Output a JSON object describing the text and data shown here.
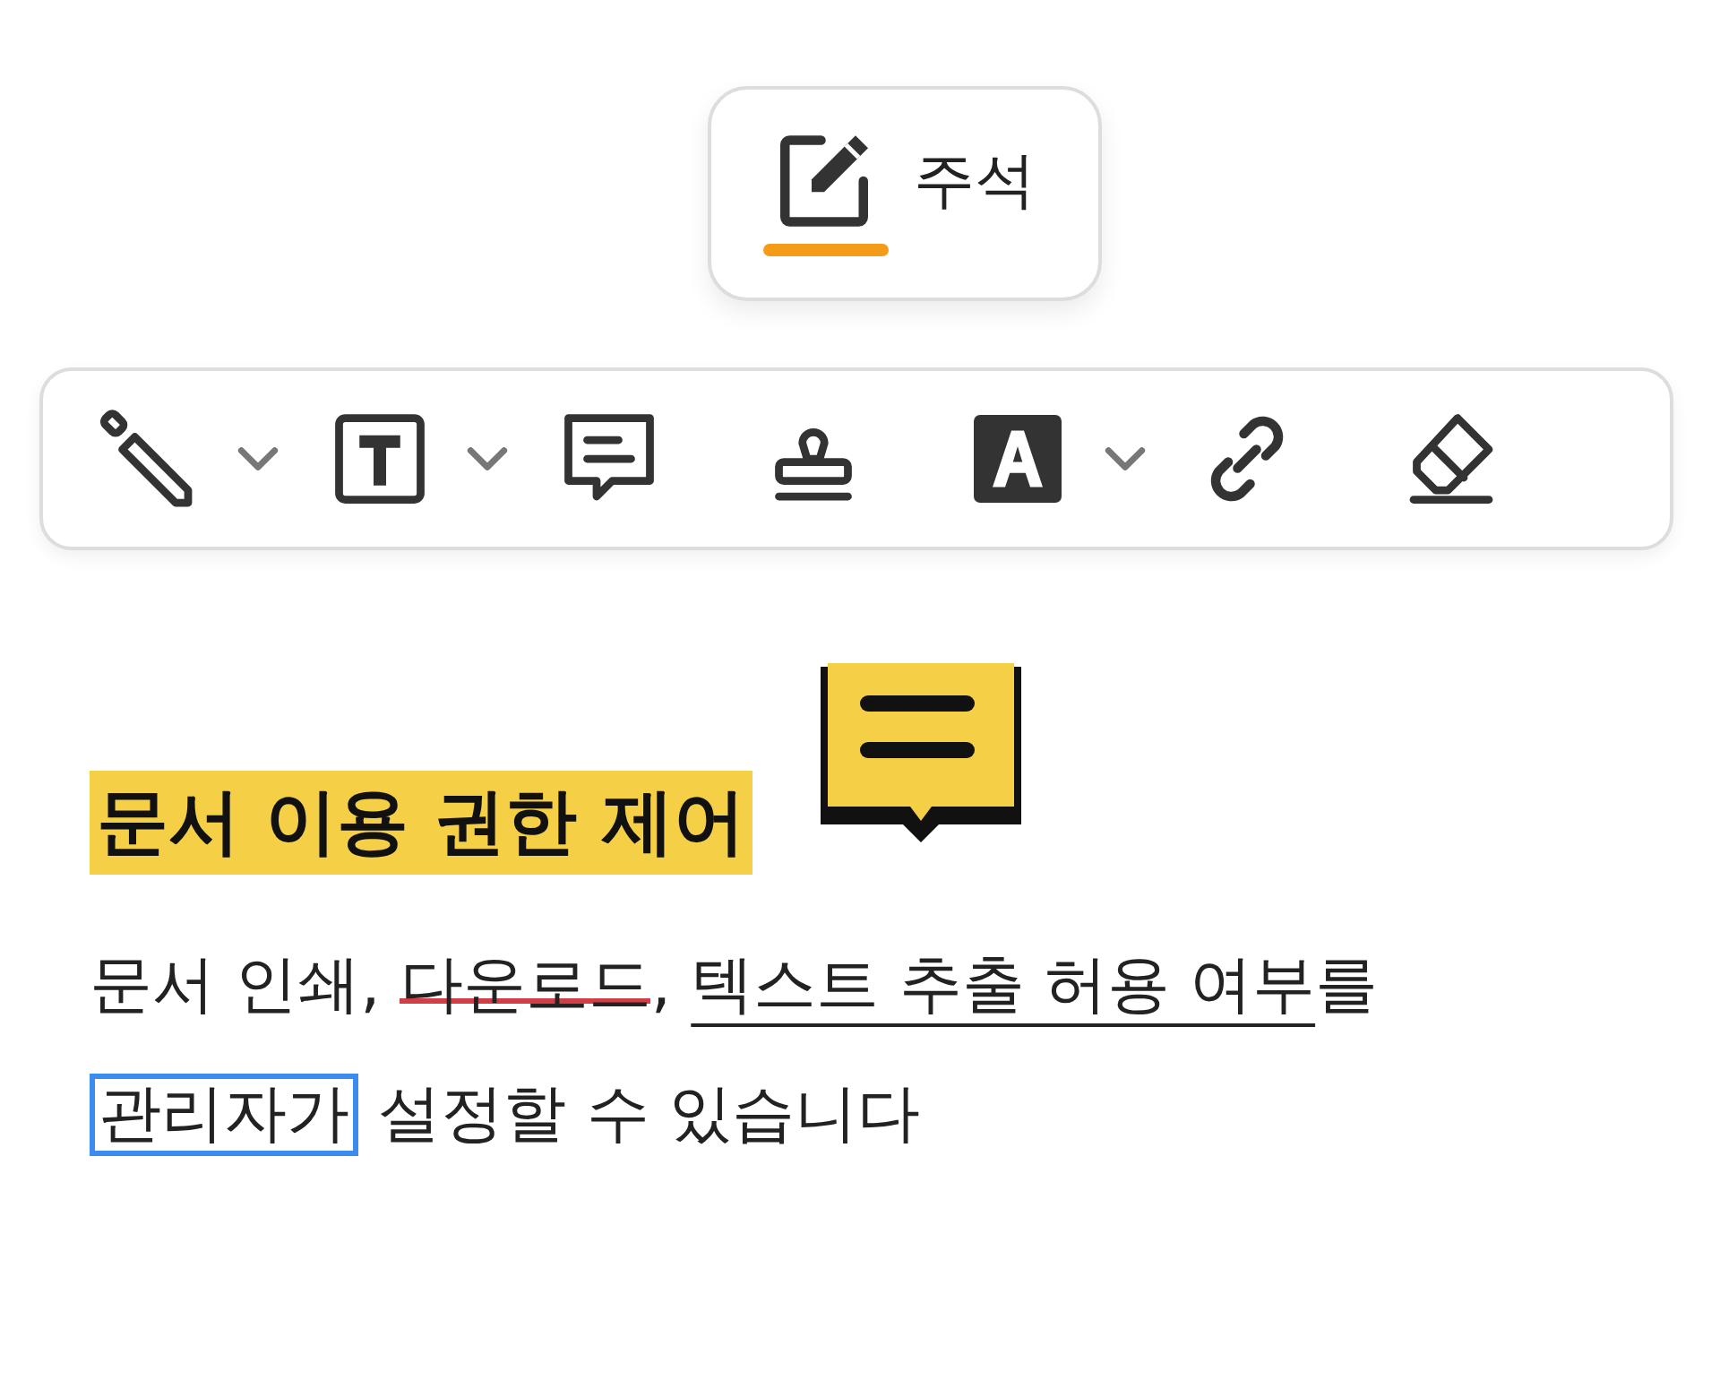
{
  "annotation_tab": {
    "label": "주석",
    "selected": true
  },
  "toolbar": [
    {
      "kind": "pen",
      "dropdown": true
    },
    {
      "kind": "textbox",
      "dropdown": true
    },
    {
      "kind": "comment",
      "dropdown": false
    },
    {
      "kind": "stamp",
      "dropdown": false
    },
    {
      "kind": "textcolor",
      "dropdown": true
    },
    {
      "kind": "link",
      "dropdown": false
    },
    {
      "kind": "eraser",
      "dropdown": false
    }
  ],
  "document": {
    "heading": "문서 이용 권한 제어",
    "paragraph_lines": [
      [
        {
          "kind": "plain",
          "text": "문서 인쇄, "
        },
        {
          "kind": "strike",
          "text": "다운로드"
        },
        {
          "kind": "plain",
          "text": ", "
        },
        {
          "kind": "underline",
          "text": "텍스트 추출 허용 여부"
        },
        {
          "kind": "plain",
          "text": "를"
        }
      ],
      [
        {
          "kind": "boxed",
          "text": "관리자가"
        },
        {
          "kind": "plain",
          "text": " 설정할 수 있습니다"
        }
      ]
    ]
  }
}
